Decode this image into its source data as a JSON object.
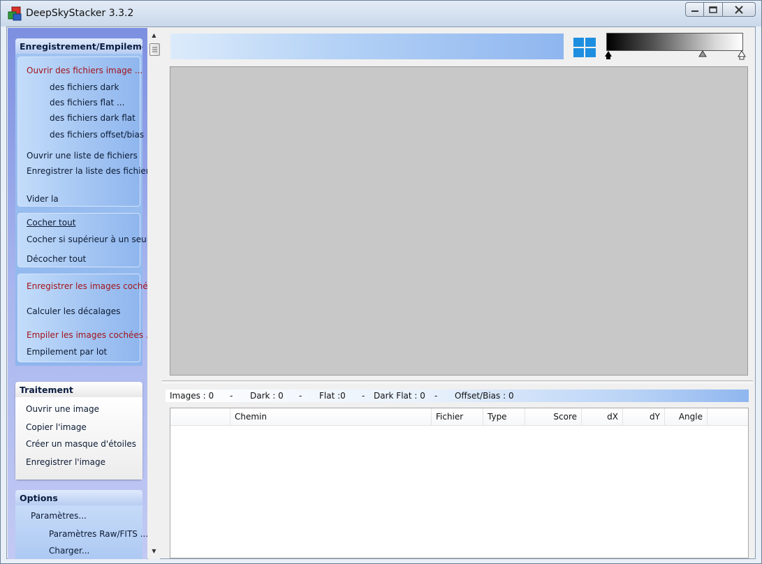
{
  "window": {
    "title": "DeepSkyStacker 3.3.2"
  },
  "left_panel": {
    "registering": {
      "header": "Enregistrement/Empilement",
      "open_files": "Ouvrir des fichiers image ...",
      "dark_files": "des fichiers dark",
      "flat_files": "des fichiers flat ...",
      "dark_flat_files": "des fichiers dark flat",
      "offset_files": "des fichiers offset/bias ...",
      "open_list": "Ouvrir une liste de fichiers",
      "save_list": "Enregistrer la liste des fichiers",
      "clear_list": "Vider la",
      "check_all": "Cocher tout",
      "check_above": "Cocher si supérieur à un seuil",
      "uncheck_all": "Décocher tout",
      "register_checked": "Enregistrer les images cochées",
      "compute_offsets": "Calculer les décalages",
      "stack_checked": "Empiler les images cochées ...",
      "batch_stacking": "Empilement par lot"
    },
    "processing": {
      "header": "Traitement",
      "open_image": "Ouvrir une image",
      "copy_image": "Copier l'image",
      "star_mask": "Créer un masque d'étoiles",
      "save_image": "Enregistrer l'image"
    },
    "options": {
      "header": "Options",
      "settings": "Paramètres...",
      "raw_fits": "Paramètres Raw/FITS ...",
      "load": "Charger..."
    }
  },
  "status": {
    "images": "Images : 0",
    "dark": "Dark : 0",
    "flat": "Flat :0",
    "dark_flat": "Dark Flat : 0",
    "offset": "Offset/Bias : 0",
    "sep": "-"
  },
  "table": {
    "columns": [
      "",
      "Chemin",
      "Fichier",
      "Type",
      "Score",
      "dX",
      "dY",
      "Angle"
    ]
  }
}
